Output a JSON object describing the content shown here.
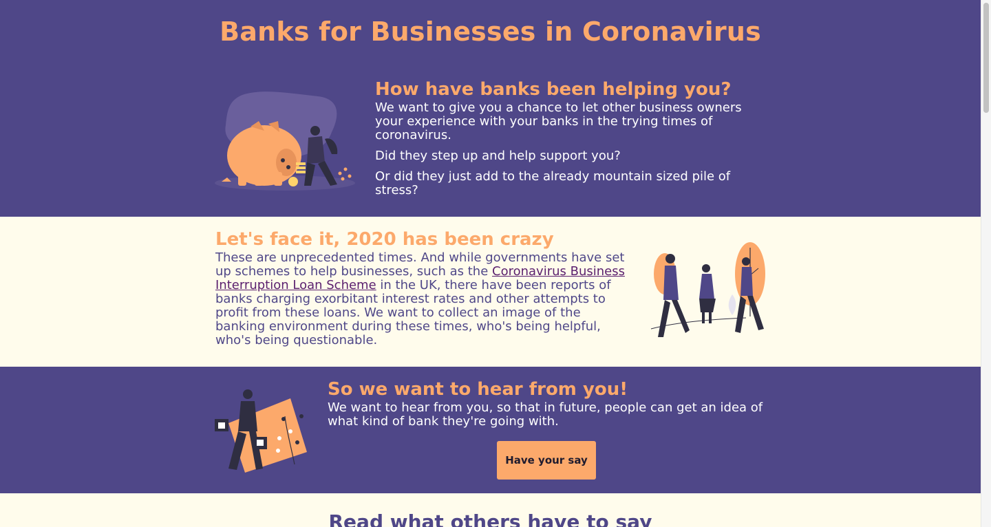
{
  "header": {
    "title": "Banks for Businesses in Coronavirus"
  },
  "section_help": {
    "heading": "How have banks been helping you?",
    "paragraphs": [
      "We want to give you a chance to let other business owners your experience with your banks in the trying times of coronavirus.",
      "Did they step up and help support you?",
      "Or did they just add to the already mountain sized pile of stress?"
    ]
  },
  "section_crazy": {
    "heading": "Let's face it, 2020 has been crazy",
    "text_before": "These are unprecedented times. And while governments have set up schemes to help businesses, such as the ",
    "link_text": "Coronavirus Business Interruption Loan Scheme",
    "text_after": " in the UK, there have been reports of banks charging exorbitant interest rates and other attempts to profit from these loans. We want to collect an image of the banking environment during these times, who's being helpful, who's being questionable."
  },
  "section_hear": {
    "heading": "So we want to hear from you!",
    "paragraph": "We want to hear from you, so that in future, people can get an idea of what kind of bank they're going with.",
    "button_label": "Have your say"
  },
  "section_read": {
    "heading": "Read what others have to say"
  },
  "colors": {
    "purple": "#4f4788",
    "orange": "#fca96b",
    "cream": "#fffcec",
    "dark": "#2f2e41"
  }
}
